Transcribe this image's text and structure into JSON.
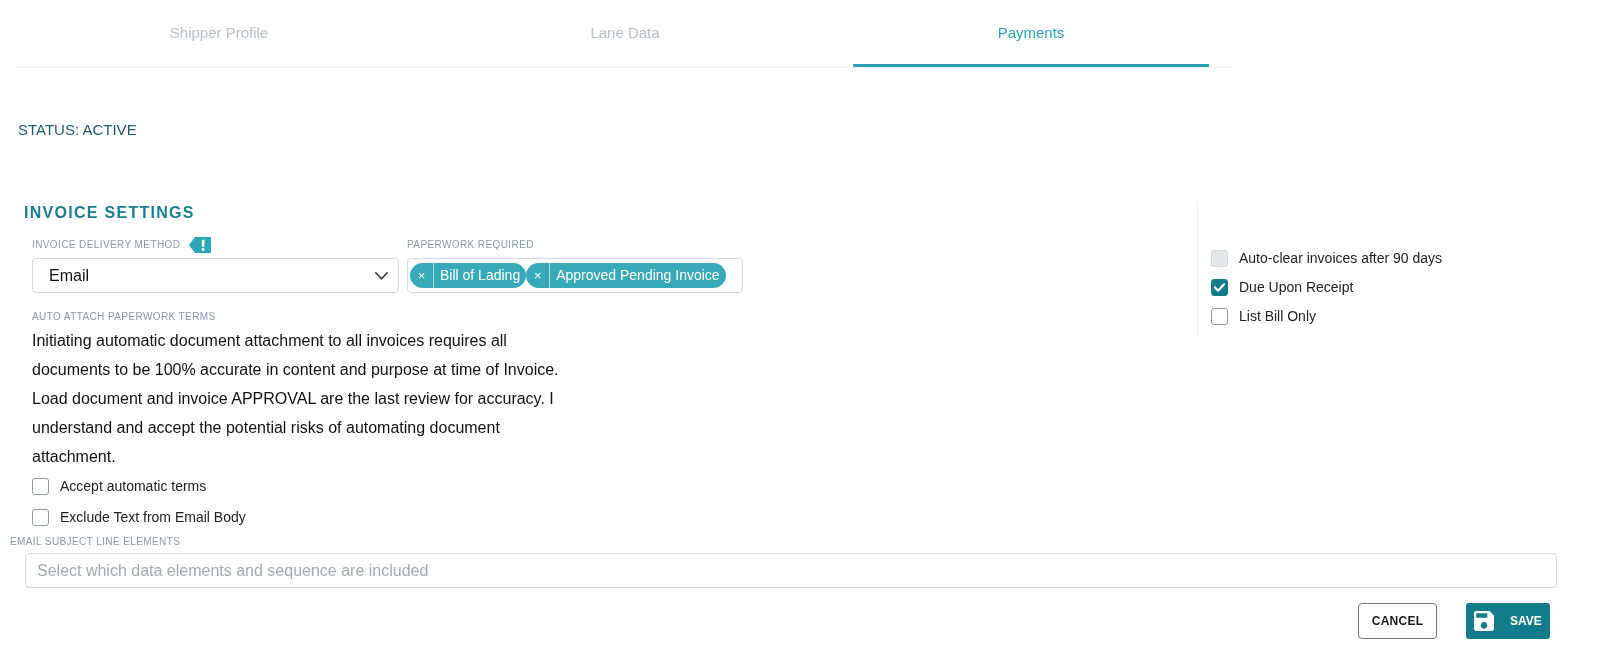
{
  "tabs": [
    {
      "label": "Shipper Profile",
      "selected": false
    },
    {
      "label": "Lane Data",
      "selected": false
    },
    {
      "label": "Payments",
      "selected": true
    }
  ],
  "status": "STATUS: ACTIVE",
  "invoice_settings": {
    "title": "INVOICE SETTINGS",
    "delivery_method": {
      "label": "INVOICE DELIVERY METHOD",
      "value": "Email"
    },
    "paperwork_required": {
      "label": "PAPERWORK REQUIRED",
      "tags": [
        {
          "remove": "×",
          "label": "Bill of Lading"
        },
        {
          "remove": "×",
          "label": "Approved Pending Invoice"
        }
      ]
    },
    "auto_attach_terms": {
      "label": "AUTO ATTACH PAPERWORK TERMS",
      "text": "Initiating automatic document attachment to all invoices requires all documents to be 100% accurate in content and purpose at time of Invoice. Load document and invoice APPROVAL are the last review for accuracy. I understand and accept the potential risks of automating document attachment."
    },
    "options": [
      {
        "label": "Accept automatic terms",
        "checked": false
      },
      {
        "label": "Exclude Text from Email Body",
        "checked": false
      }
    ]
  },
  "side_options": [
    {
      "label": "Auto-clear invoices after 90 days",
      "checked": false,
      "disabled": true
    },
    {
      "label": "Due Upon Receipt",
      "checked": true,
      "disabled": false
    },
    {
      "label": "List Bill Only",
      "checked": false,
      "disabled": false
    }
  ],
  "email_subject": {
    "label": "EMAIL SUBJECT LINE ELEMENTS",
    "placeholder": "Select which data elements and sequence are included"
  },
  "buttons": [
    {
      "label": "CANCEL",
      "kind": "cancel"
    },
    {
      "label": "SAVE",
      "kind": "save"
    }
  ]
}
